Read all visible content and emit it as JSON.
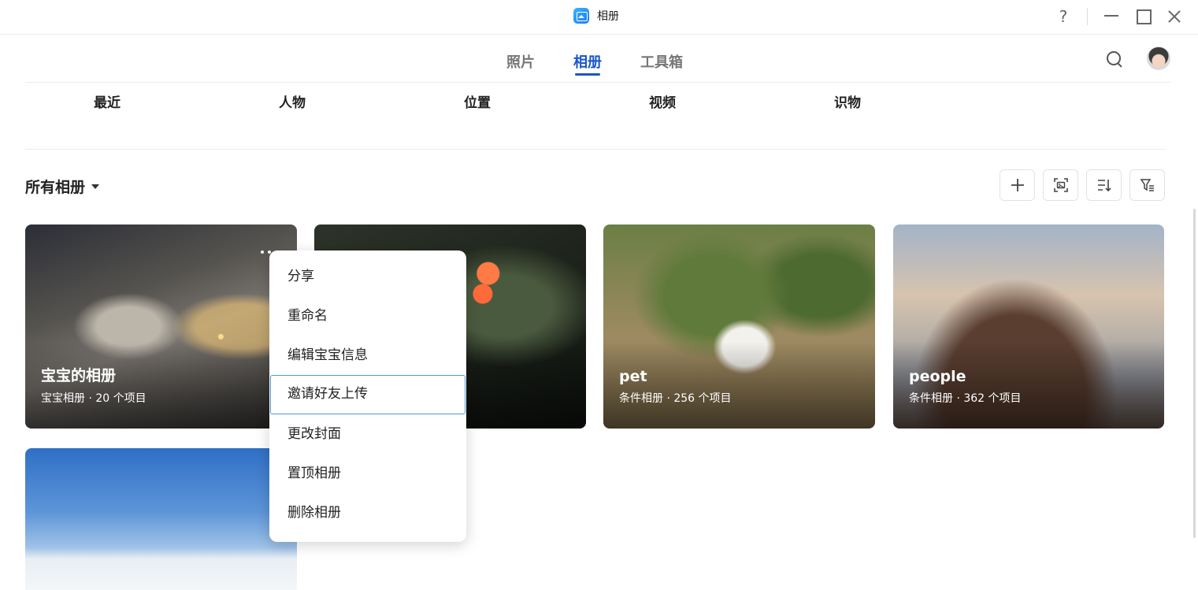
{
  "window": {
    "title": "相册",
    "help_label": "?"
  },
  "main_tabs": [
    {
      "label": "照片",
      "active": false
    },
    {
      "label": "相册",
      "active": true
    },
    {
      "label": "工具箱",
      "active": false
    }
  ],
  "sub_tabs": [
    "最近",
    "人物",
    "位置",
    "视频",
    "识物"
  ],
  "section": {
    "title": "所有相册"
  },
  "toolbar": {
    "icons": [
      "plus-icon",
      "face-scan-icon",
      "sort-icon",
      "filter-icon"
    ]
  },
  "albums": [
    {
      "name": "宝宝的相册",
      "meta": "宝宝相册 · 20 个项目"
    },
    {
      "name": "",
      "meta": ""
    },
    {
      "name": "pet",
      "meta": "条件相册 · 256 个项目"
    },
    {
      "name": "people",
      "meta": "条件相册 · 362 个项目"
    },
    {
      "name": "",
      "meta": ""
    }
  ],
  "context_menu": {
    "items": [
      "分享",
      "重命名",
      "编辑宝宝信息",
      "邀请好友上传",
      "更改封面",
      "置顶相册",
      "删除相册"
    ],
    "highlighted_index": 3
  },
  "colors": {
    "accent": "#1a56c7",
    "menu_highlight_border": "#4a9ad8"
  }
}
